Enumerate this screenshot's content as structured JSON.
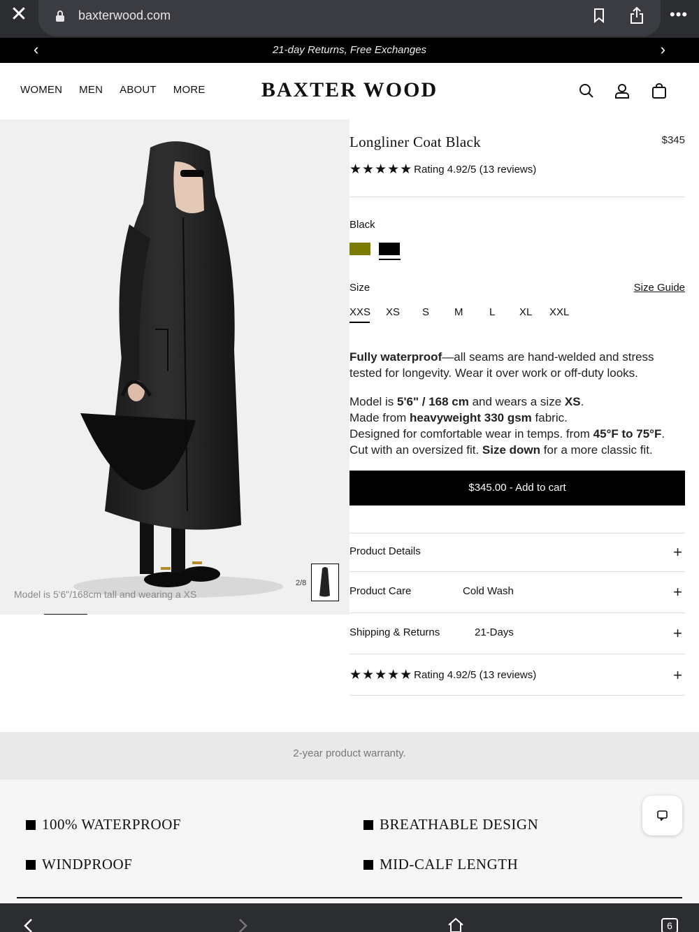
{
  "browser": {
    "url": "baxterwood.com",
    "tab_count": "6",
    "icons": [
      "close-icon",
      "lock-icon",
      "bookmark-icon",
      "share-icon",
      "more-icon",
      "back-icon",
      "forward-icon",
      "home-icon",
      "tabs-icon"
    ]
  },
  "announcement": {
    "text": "21-day Returns, Free Exchanges",
    "prev": "‹",
    "next": "›"
  },
  "header": {
    "nav": [
      "WOMEN",
      "MEN",
      "ABOUT",
      "MORE"
    ],
    "logo": "BAXTER WOOD",
    "icons": [
      "search-icon",
      "account-icon",
      "bag-icon"
    ]
  },
  "gallery": {
    "caption": "Model is 5'6\"/168cm tall and wearing a XS",
    "counter": "2/8"
  },
  "product": {
    "title": "Longliner Coat Black",
    "price": "$345",
    "rating_text": "Rating 4.92/5 (13 reviews)",
    "stars": "★★★★★",
    "color_label": "Black",
    "colors": [
      {
        "name": "olive",
        "hex": "#7c7c00"
      },
      {
        "name": "black",
        "hex": "#000000"
      }
    ],
    "size_label": "Size",
    "size_guide": "Size Guide",
    "sizes": [
      "XXS",
      "XS",
      "S",
      "M",
      "L",
      "XL",
      "XXL"
    ],
    "selected_size": "XXS",
    "desc1_bold": "Fully waterproof",
    "desc1_rest": "—all seams are hand-welded and stress tested for longevity. Wear it over work or off-duty looks.",
    "desc2": {
      "l1_a": "Model is ",
      "l1_b": "5'6\" / 168 cm",
      "l1_c": " and wears a size ",
      "l1_d": "XS",
      "l1_e": ".",
      "l2_a": "Made from ",
      "l2_b": "heavyweight 330 gsm",
      "l2_c": " fabric.",
      "l3_a": "Designed for comfortable wear in temps. from ",
      "l3_b": "45°F to 75°F",
      "l3_c": ".",
      "l4_a": "Cut with an oversized fit. ",
      "l4_b": "Size down",
      "l4_c": " for a more classic fit."
    },
    "cart_label": "$345.00  -  Add to cart",
    "accordion": [
      {
        "label": "Product Details",
        "value": ""
      },
      {
        "label": "Product Care",
        "value": "Cold Wash"
      },
      {
        "label": "Shipping & Returns",
        "value": "21-Days"
      },
      {
        "label": "Rating 4.92/5 (13 reviews)",
        "value": ""
      }
    ],
    "plus": "+"
  },
  "warranty": "2-year product warranty.",
  "features": [
    "100% WATERPROOF",
    "BREATHABLE DESIGN",
    "WINDPROOF",
    "MID-CALF LENGTH"
  ]
}
